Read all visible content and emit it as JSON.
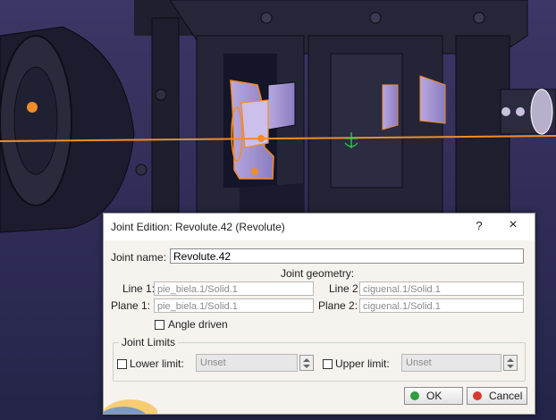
{
  "dialog": {
    "title": "Joint Edition: Revolute.42 (Revolute)",
    "help_glyph": "?",
    "close_glyph": "×"
  },
  "joint_name": {
    "label": "Joint name:",
    "value": "Revolute.42"
  },
  "geometry": {
    "heading": "Joint geometry:",
    "line1": {
      "label": "Line 1:",
      "value": "pie_biela.1/Solid.1"
    },
    "plane1": {
      "label": "Plane 1:",
      "value": "pie_biela.1/Solid.1"
    },
    "line2": {
      "label": "Line 2:",
      "value": "ciguenal.1/Solid.1"
    },
    "plane2": {
      "label": "Plane 2:",
      "value": "ciguenal.1/Solid.1"
    }
  },
  "angle_driven": {
    "label": "Angle driven",
    "checked": false
  },
  "limits": {
    "legend": "Joint Limits",
    "lower": {
      "label": "Lower limit:",
      "value": "Unset",
      "checked": false
    },
    "upper": {
      "label": "Upper limit:",
      "value": "Unset",
      "checked": false
    }
  },
  "buttons": {
    "ok_label": "OK",
    "cancel_label": "Cancel"
  },
  "colors": {
    "viewport_background": "#2b2b52",
    "selection_highlight": "#f28c28",
    "ok_icon": "#2e9e3f",
    "cancel_icon": "#d43a2f"
  }
}
